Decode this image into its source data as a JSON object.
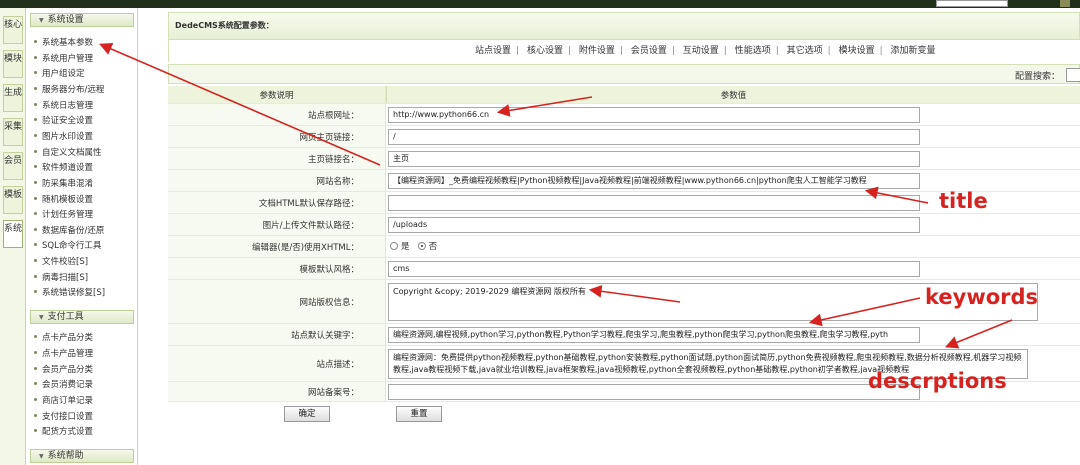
{
  "sidebar_tabs": [
    "核心",
    "模块",
    "生成",
    "采集",
    "会员",
    "模板",
    "系统"
  ],
  "menu": {
    "section1_title": "系统设置",
    "section1_items": [
      "系统基本参数",
      "系统用户管理",
      "用户组设定",
      "服务器分布/远程",
      "系统日志管理",
      "验证安全设置",
      "图片水印设置",
      "自定义文档属性",
      "软件频道设置",
      "防采集串混淆",
      "随机模板设置",
      "计划任务管理",
      "数据库备份/还原",
      "SQL命令行工具",
      "文件校验[S]",
      "病毒扫描[S]",
      "系统错误修复[S]"
    ],
    "section2_title": "支付工具",
    "section2_items": [
      "点卡产品分类",
      "点卡产品管理",
      "会员产品分类",
      "会员消费记录",
      "商店订单记录",
      "支付接口设置",
      "配货方式设置"
    ],
    "section3_title": "系统帮助"
  },
  "main": {
    "crumb": "DedeCMS系统配置参数：",
    "tabs": [
      "站点设置",
      "核心设置",
      "附件设置",
      "会员设置",
      "互动设置",
      "性能选项",
      "其它选项",
      "模块设置",
      "添加新变量"
    ],
    "search_label": "配置搜索：",
    "header_label": "参数说明",
    "header_value": "参数值",
    "fields": {
      "site_url_label": "站点根网址：",
      "site_url": "http://www.python66.cn",
      "home_link_label": "网页主页链接：",
      "home_link": "/",
      "home_name_label": "主页链接名：",
      "home_name": "主页",
      "site_name_label": "网站名称：",
      "site_name": "【编程资源网】_免费编程视频教程|Python视频教程|Java视频教程|前端视频教程|www.python66.cn|python爬虫人工智能学习教程",
      "html_path_label": "文档HTML默认保存路径：",
      "html_path": "",
      "upload_path_label": "图片/上传文件默认路径：",
      "upload_path": "/uploads",
      "editor_label": "编辑器(是/否)使用XHTML：",
      "editor_yes": "是",
      "editor_no": "否",
      "template_label": "模板默认风格：",
      "template": "cms",
      "copyright_label": "网站版权信息：",
      "copyright": "Copyright &copy; 2019-2029 编程资源网 版权所有",
      "keywords_label": "站点默认关键字：",
      "keywords": "编程资源网,编程视频,python学习,python教程,Python学习教程,爬虫学习,爬虫教程,python爬虫学习,python爬虫教程,爬虫学习教程,pyth",
      "description_label": "站点描述：",
      "description": "编程资源网：免费提供python视频教程,python基础教程,python安装教程,python面试题,python面试简历,python免费视频教程,爬虫视频教程,数据分析视频教程,机器学习视频教程,java教程视频下载,java就业培训教程,java框架教程,java视频教程,python全套视频教程,python基础教程,python初学者教程,java视频教程",
      "beian_label": "网站备案号：",
      "beian": ""
    },
    "confirm_btn": "确定",
    "reset_btn": "重置"
  },
  "annotations": {
    "title": "title",
    "keywords": "keywords",
    "descriptions": "descrptions",
    "color": "#d62320"
  }
}
